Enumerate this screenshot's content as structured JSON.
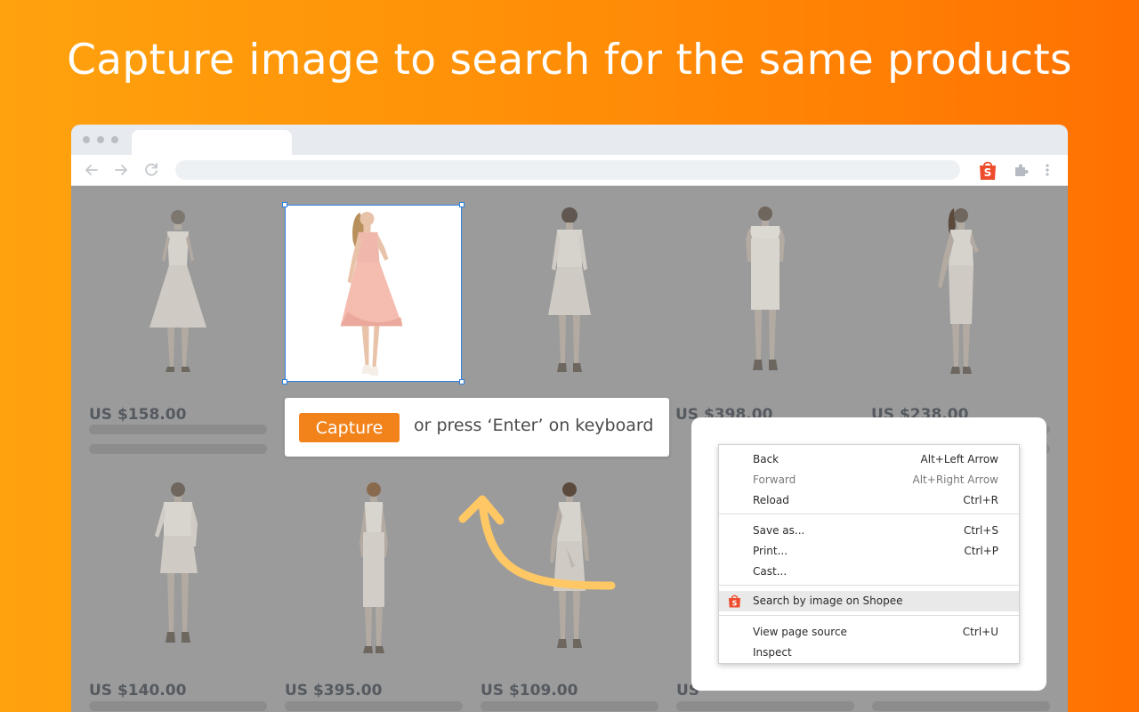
{
  "headline": "Capture image to search for the same products",
  "browser": {
    "icons": {
      "back": "back-arrow-icon",
      "forward": "forward-arrow-icon",
      "reload": "reload-icon",
      "extension": "shopee-bag-icon",
      "puzzle": "puzzle-icon",
      "menu": "kebab-menu-icon"
    },
    "extension_letter": "S"
  },
  "products": [
    {
      "price": "US $158.00",
      "dress": "white sleeveless"
    },
    {
      "price": "",
      "dress": "pink short-sleeve (selected)"
    },
    {
      "price": "US $398.00",
      "dress": "white three-quarter sleeve"
    },
    {
      "price": "US $238.00",
      "dress": "white short sleeve sheath"
    },
    {
      "price": "",
      "dress": "white cold-shoulder"
    },
    {
      "price": "US $140.00",
      "dress": "white wrap"
    },
    {
      "price": "US $395.00",
      "dress": "white sleeveless midi"
    },
    {
      "price": "US $109.00",
      "dress": "white tie-waist"
    },
    {
      "price": "US",
      "dress": "partially hidden"
    }
  ],
  "capture": {
    "button_label": "Capture",
    "hint": "or press ‘Enter’ on keyboard"
  },
  "context_menu": {
    "items": [
      {
        "label": "Back",
        "shortcut": "Alt+Left Arrow"
      },
      {
        "label": "Forward",
        "shortcut": "Alt+Right Arrow"
      },
      {
        "label": "Reload",
        "shortcut": "Ctrl+R"
      },
      {
        "label": "Save as...",
        "shortcut": "Ctrl+S"
      },
      {
        "label": "Print...",
        "shortcut": "Ctrl+P"
      },
      {
        "label": "Cast...",
        "shortcut": ""
      },
      {
        "label": "Search by image on Shopee",
        "shortcut": "",
        "icon": "shopee-bag-icon",
        "letter": "S"
      },
      {
        "label": "View page source",
        "shortcut": "Ctrl+U"
      },
      {
        "label": "Inspect",
        "shortcut": ""
      }
    ]
  },
  "colors": {
    "accent": "#f2831b",
    "shopee": "#ee4d2d",
    "arrow": "#ffc864",
    "selection": "#2f7fe0"
  }
}
